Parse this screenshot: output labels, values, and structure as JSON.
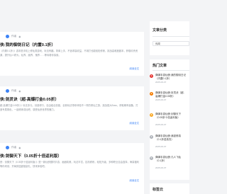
{
  "colors": {
    "accent": "#3b82f6",
    "rank_1": "#e53935",
    "rank_2": "#f57c00",
    "rank_3": "#f9a825",
    "rank_other": "#b0b4ba"
  },
  "posts": [
    {
      "author": "作者",
      "title": "侠:我的御剑日记（内置0.1折）",
      "excerpt": "（内置0.1折）》游本是手机上修仙类游戏，玩法有趣。简单上手，不追求高收益，不用打也能轻松修炼，挑战高难度副本，获取珍贵资源，提升仙人修为，仙界、魔界、鬼界……等待着你探索。",
      "more": "阅读全文"
    },
    {
      "author": "作者",
      "title": "侠:剑灵诀（超-高爆打金0.05折）",
      "excerpt": "超-高爆打金0.05折）》玩法多元，剑道修行，自由组合技能，全新玩法带你体验不一样的修仙之旅，挑战强大Boss，获取稀有装备，打造专属角色，一起修炼成仙吧，感受仙侠世界的魅力。",
      "more": "阅读全文"
    },
    {
      "author": "作者",
      "title": "侠:剑御天下（0.05折十倍返利版）",
      "excerpt": "侠：剑御天下（0.05折十倍返利版）》是一款仙侠题材手游，画面精美，玩法丰富，挂机修炼，轻松升级，多种职业自由选择，海量福利等你来领，开局即送超值豪礼，快来体验吧。",
      "more": "阅读全文"
    }
  ],
  "sidebar": {
    "categories_title": "文章分类",
    "category_selected": "传闻",
    "hot_title": "热门文章",
    "hot": [
      {
        "title": "弹弹手游仙侠:我的御剑日记（内置0.1折）",
        "date": "2025-06-07"
      },
      {
        "title": "弹弹手游仙侠:封灵诀（超-高爆打金0.05折）",
        "date": "2025-06-07"
      },
      {
        "title": "弹弹手游仙侠:剑御天下（0.05折十倍返利版）",
        "date": "2025-06-07"
      },
      {
        "title": "弹弹手游仙侠:我欲修真（0.1折送真充）",
        "date": "2025-06-07"
      },
      {
        "title": "弹弹手游仙侠:凡人飞仙（0.1折）",
        "date": "2025-06-07"
      }
    ],
    "tags_title": "标签云"
  }
}
